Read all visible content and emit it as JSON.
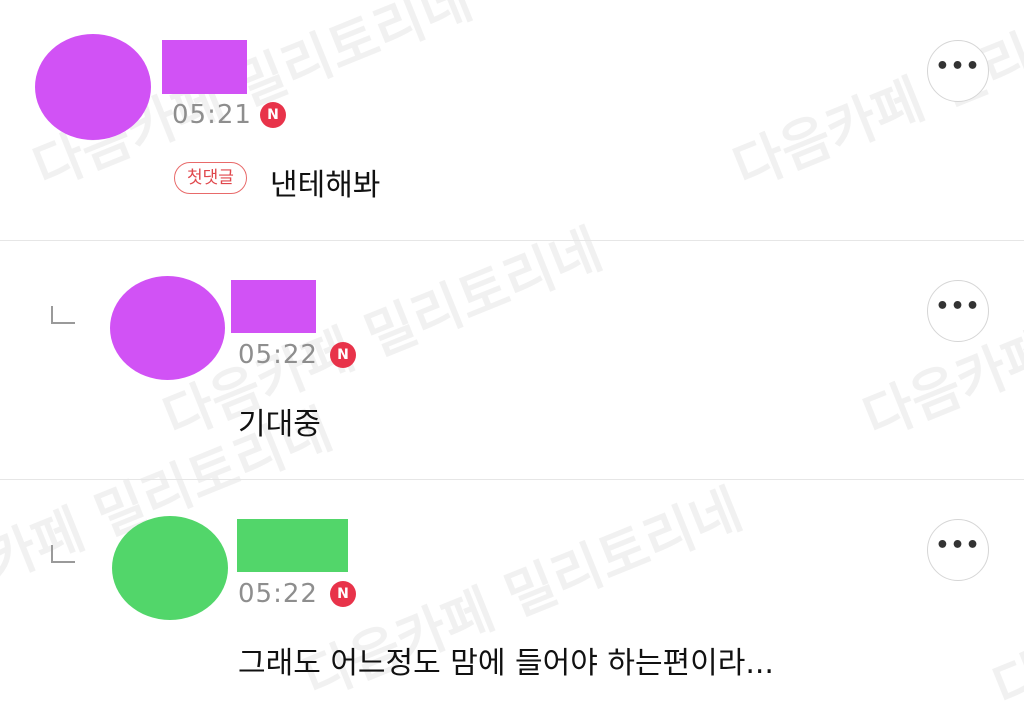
{
  "watermark": "다음카페 밀리토리네",
  "colors": {
    "purple": "#d152f5",
    "green": "#52d66a",
    "badge_red": "#e8334a"
  },
  "comments": [
    {
      "time": "05:21",
      "new_badge": "N",
      "first_badge": "첫댓글",
      "text": "낸테해봐",
      "more": "•••",
      "avatar_color": "#d152f5"
    },
    {
      "time": "05:22",
      "new_badge": "N",
      "text": "기대중",
      "more": "•••",
      "avatar_color": "#d152f5"
    },
    {
      "time": "05:22",
      "new_badge": "N",
      "text": "그래도 어느정도 맘에 들어야 하는편이라...",
      "more": "•••",
      "avatar_color": "#52d66a"
    }
  ]
}
